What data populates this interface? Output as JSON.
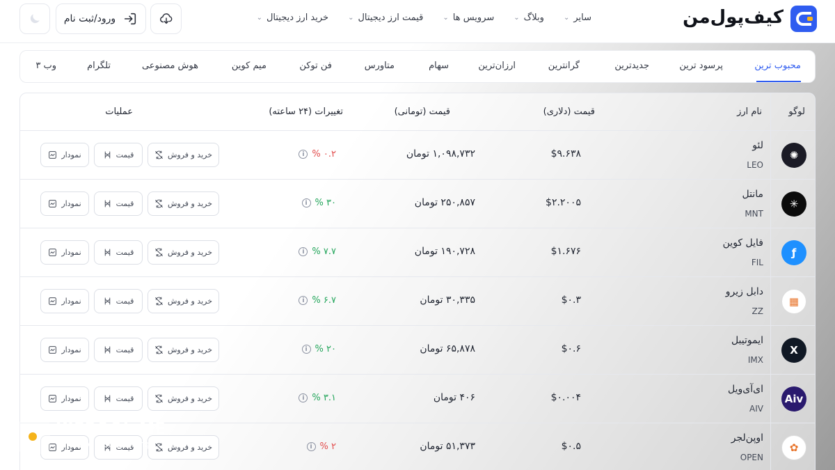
{
  "header": {
    "brand": "کیف‌پول‌من",
    "nav": [
      {
        "label": "خرید ارز دیجیتال"
      },
      {
        "label": "قیمت ارز دیجیتال"
      },
      {
        "label": "سرویس ها"
      },
      {
        "label": "وبلاگ"
      },
      {
        "label": "سایر"
      }
    ],
    "login_label": "ورود/ثبت نام",
    "icons": {
      "logo": "wallet-logo-icon",
      "login": "login-arrow-icon",
      "cloud": "cloud-download-icon",
      "theme": "moon-icon"
    },
    "accent_color": "#2f5cf0"
  },
  "tabs": [
    {
      "label": "محبوب ترین",
      "active": true
    },
    {
      "label": "پرسود ترین"
    },
    {
      "label": "جدیدترین"
    },
    {
      "label": "گرانترین"
    },
    {
      "label": "ارزان‌ترین"
    },
    {
      "label": "سهام"
    },
    {
      "label": "متاورس"
    },
    {
      "label": "فن توکن"
    },
    {
      "label": "میم کوین"
    },
    {
      "label": "هوش مصنوعی"
    },
    {
      "label": "تلگرام"
    },
    {
      "label": "وب ۳"
    }
  ],
  "table": {
    "headers": {
      "logo": "لوگو",
      "name": "نام ارز",
      "usd": "قیمت (دلاری)",
      "toman": "قیمت (تومانی)",
      "change": "تغییرات (۲۴ ساعته)",
      "actions": "عملیات"
    },
    "action_labels": {
      "trade": "خرید و فروش",
      "price": "قیمت",
      "chart": "نمودار"
    },
    "rows": [
      {
        "name": "لئو",
        "symbol": "LEO",
        "usd": "$۹.۶۳۸",
        "toman": "۱,۰۹۸,۷۳۲ تومان",
        "change": "% ۰.۲",
        "direction": "down",
        "logo_color": "#1b1b26",
        "logo_glyph": "✺"
      },
      {
        "name": "مانتل",
        "symbol": "MNT",
        "usd": "$۲.۲۰۰۵",
        "toman": "۲۵۰,۸۵۷ تومان",
        "change": "% ۳۰",
        "direction": "up",
        "logo_color": "#0b0b0b",
        "logo_glyph": "✳"
      },
      {
        "name": "فایل کوین",
        "symbol": "FIL",
        "usd": "$۱.۶۷۶",
        "toman": "۱۹۰,۷۲۸ تومان",
        "change": "% ۷.۷",
        "direction": "up",
        "logo_color": "#1e90ff",
        "logo_glyph": "ƒ"
      },
      {
        "name": "دابل زیرو",
        "symbol": "ZZ",
        "usd": "$۰.۳",
        "toman": "۳۰,۳۳۵ تومان",
        "change": "% ۶.۷",
        "direction": "up",
        "logo_color": "#ffffff",
        "logo_glyph": "▦"
      },
      {
        "name": "ایموتیبل",
        "symbol": "IMX",
        "usd": "$۰.۶",
        "toman": "۶۵,۸۷۸ تومان",
        "change": "% ۲۰",
        "direction": "up",
        "logo_color": "#101824",
        "logo_glyph": "X"
      },
      {
        "name": "ای‌آی‌ویل",
        "symbol": "AIV",
        "usd": "$۰.۰۰۴",
        "toman": "۴۰۶ تومان",
        "change": "% ۳.۱",
        "direction": "up",
        "logo_color": "#2a1a6e",
        "logo_glyph": "Aiv"
      },
      {
        "name": "اوپن‌لجر",
        "symbol": "OPEN",
        "usd": "$۰.۵",
        "toman": "۵۱,۳۷۳ تومان",
        "change": "% ۲",
        "direction": "down",
        "logo_color": "#ffffff",
        "logo_glyph": "✿"
      }
    ]
  },
  "watermark": {
    "title": "KIFPOOL.ME",
    "subtitle": "Safe and fast exchange"
  }
}
